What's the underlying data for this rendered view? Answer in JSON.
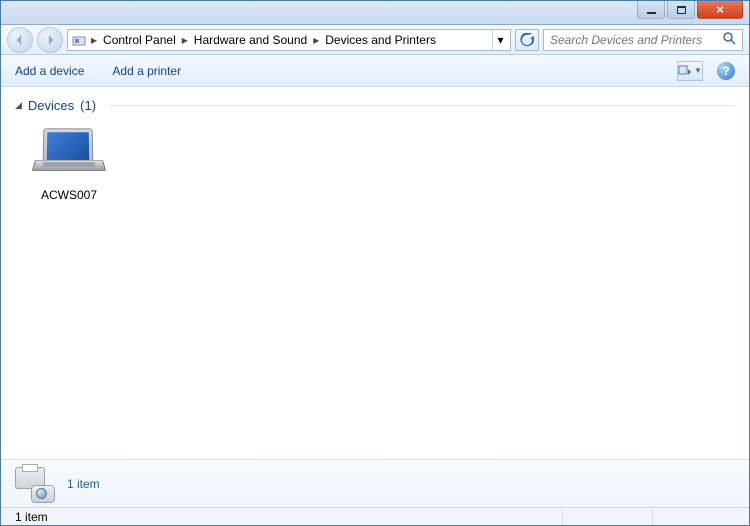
{
  "window": {
    "min": "–",
    "max": "▢",
    "close": "×"
  },
  "breadcrumb": [
    "Control Panel",
    "Hardware and Sound",
    "Devices and Printers"
  ],
  "search": {
    "placeholder": "Search Devices and Printers"
  },
  "toolbar": {
    "add_device": "Add a device",
    "add_printer": "Add a printer"
  },
  "section": {
    "title": "Devices",
    "count_label": "(1)"
  },
  "devices": [
    {
      "name": "ACWS007",
      "icon": "laptop"
    }
  ],
  "details": {
    "summary": "1 item"
  },
  "status": {
    "text": "1 item"
  }
}
